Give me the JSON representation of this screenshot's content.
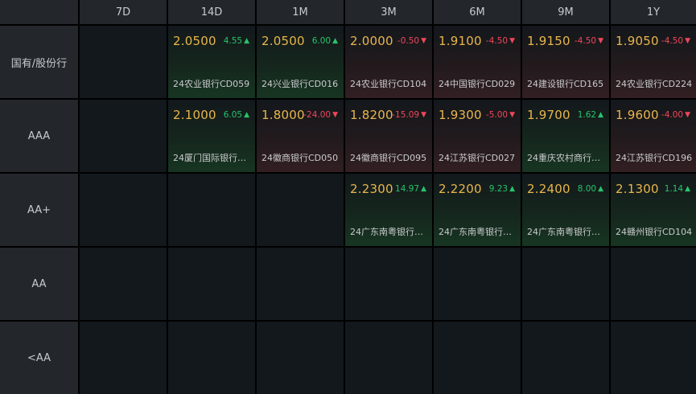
{
  "corner": "",
  "columns": [
    "7D",
    "14D",
    "1M",
    "3M",
    "6M",
    "9M",
    "1Y"
  ],
  "rows": [
    "国有/股份行",
    "AAA",
    "AA+",
    "AA",
    "<AA"
  ],
  "colors": {
    "background": "#000000",
    "header": "#23272b",
    "cell": "#13181c",
    "price": "#e8b64c",
    "up": "#27c46a",
    "down": "#f0475a",
    "text": "#c9cbcd"
  },
  "cells": [
    [
      null,
      {
        "price": "2.0500",
        "change": "4.55",
        "direction": "up",
        "bond": "24农业银行CD059"
      },
      {
        "price": "2.0500",
        "change": "6.00",
        "direction": "up",
        "bond": "24兴业银行CD016"
      },
      {
        "price": "2.0000",
        "change": "-0.50",
        "direction": "down",
        "bond": "24农业银行CD104"
      },
      {
        "price": "1.9100",
        "change": "-4.50",
        "direction": "down",
        "bond": "24中国银行CD029"
      },
      {
        "price": "1.9150",
        "change": "-4.50",
        "direction": "down",
        "bond": "24建设银行CD165"
      },
      {
        "price": "1.9050",
        "change": "-4.50",
        "direction": "down",
        "bond": "24农业银行CD224"
      }
    ],
    [
      null,
      {
        "price": "2.1000",
        "change": "6.05",
        "direction": "up",
        "bond": "24厦门国际银行CD..."
      },
      {
        "price": "1.8000",
        "change": "-24.00",
        "direction": "down",
        "bond": "24徽商银行CD050"
      },
      {
        "price": "1.8200",
        "change": "-15.09",
        "direction": "down",
        "bond": "24徽商银行CD095"
      },
      {
        "price": "1.9300",
        "change": "-5.00",
        "direction": "down",
        "bond": "24江苏银行CD027"
      },
      {
        "price": "1.9700",
        "change": "1.62",
        "direction": "up",
        "bond": "24重庆农村商行CD..."
      },
      {
        "price": "1.9600",
        "change": "-4.00",
        "direction": "down",
        "bond": "24江苏银行CD196"
      }
    ],
    [
      null,
      null,
      null,
      {
        "price": "2.2300",
        "change": "14.97",
        "direction": "up",
        "bond": "24广东南粤银行CD..."
      },
      {
        "price": "2.2200",
        "change": "9.23",
        "direction": "up",
        "bond": "24广东南粤银行CD..."
      },
      {
        "price": "2.2400",
        "change": "8.00",
        "direction": "up",
        "bond": "24广东南粤银行CD..."
      },
      {
        "price": "2.1300",
        "change": "1.14",
        "direction": "up",
        "bond": "24赣州银行CD104"
      }
    ],
    [
      null,
      null,
      null,
      null,
      null,
      null,
      null
    ],
    [
      null,
      null,
      null,
      null,
      null,
      null,
      null
    ]
  ]
}
